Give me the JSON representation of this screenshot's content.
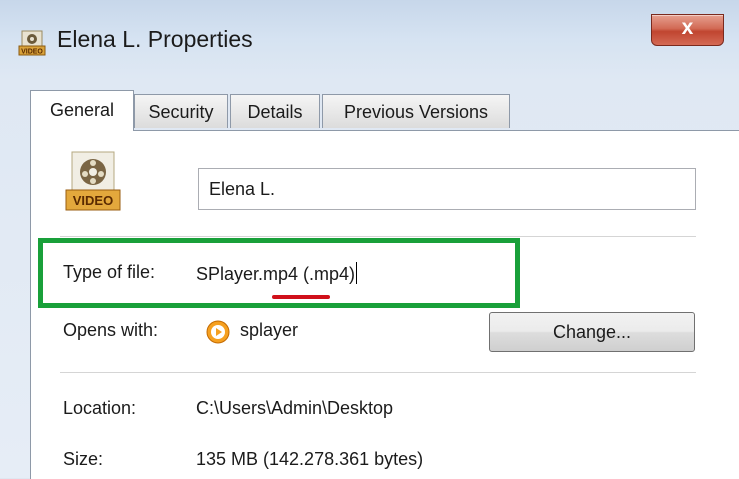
{
  "window": {
    "title": "Elena L. Properties",
    "close_glyph": "x"
  },
  "tabs": [
    {
      "label": "General",
      "active": true
    },
    {
      "label": "Security",
      "active": false
    },
    {
      "label": "Details",
      "active": false
    },
    {
      "label": "Previous Versions",
      "active": false
    }
  ],
  "file": {
    "name": "Elena L.",
    "icon_label": "VIDEO"
  },
  "properties": {
    "type_label": "Type of file:",
    "type_value": "SPlayer.mp4 (.mp4)",
    "opens_label": "Opens with:",
    "opens_value": "splayer",
    "change_button": "Change...",
    "location_label": "Location:",
    "location_value": "C:\\Users\\Admin\\Desktop",
    "size_label": "Size:",
    "size_value": "135 MB (142.278.361 bytes)"
  },
  "colors": {
    "highlight": "#19a03a",
    "underline": "#d0101a",
    "opens_icon": "#f5a020"
  }
}
